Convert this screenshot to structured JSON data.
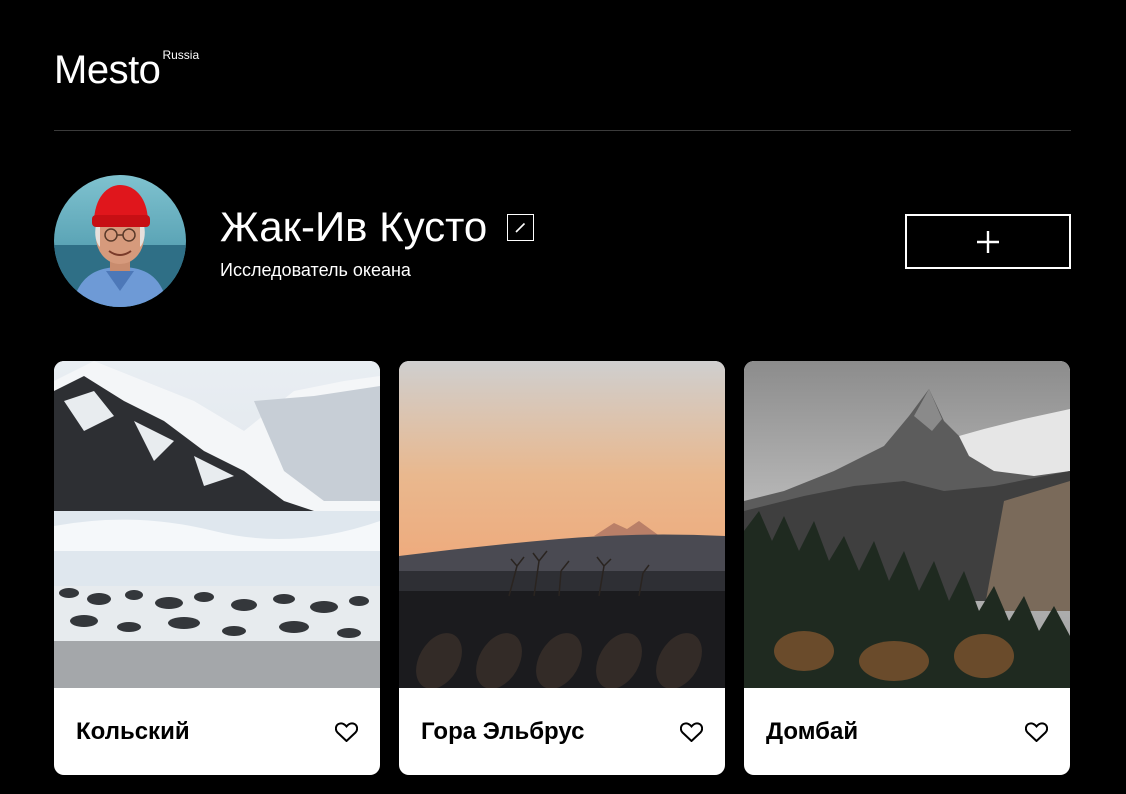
{
  "header": {
    "logo_main": "Mesto",
    "logo_sup": "Russia"
  },
  "profile": {
    "name": "Жак-Ив Кусто",
    "about": "Исследователь океана"
  },
  "cards": [
    {
      "title": "Кольский"
    },
    {
      "title": "Гора Эльбрус"
    },
    {
      "title": "Домбай"
    }
  ],
  "icons": {
    "edit": "pencil-icon",
    "add": "plus-icon",
    "like": "heart-icon"
  },
  "colors": {
    "background": "#000000",
    "card": "#ffffff",
    "text": "#ffffff",
    "divider": "#545454"
  }
}
